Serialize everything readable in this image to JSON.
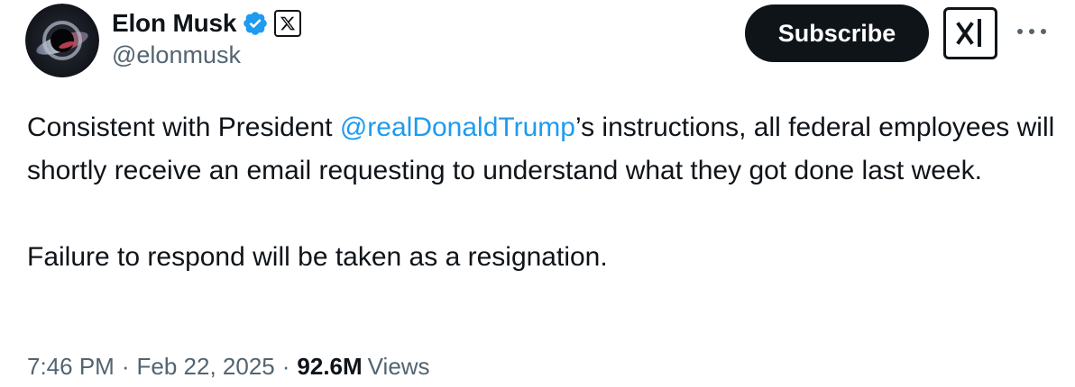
{
  "author": {
    "display_name": "Elon Musk",
    "handle": "@elonmusk",
    "verified": true,
    "affiliate_badge": "X"
  },
  "actions": {
    "subscribe_label": "Subscribe",
    "brand_logo": "xai-logo",
    "more_icon": "ellipsis-icon"
  },
  "tweet": {
    "text_before_mention": "Consistent with President ",
    "mention": "@realDonaldTrump",
    "text_after_mention": "’s instructions, all federal employees will shortly receive an email requesting to understand what they got done last week.",
    "paragraph_2": "Failure to respond will be taken as a resignation."
  },
  "meta": {
    "time": "7:46 PM",
    "separator": "·",
    "date": "Feb 22, 2025",
    "views_count": "92.6M",
    "views_label": "Views"
  },
  "colors": {
    "text": "#0f1419",
    "secondary": "#536471",
    "link": "#1d9bf0",
    "verified": "#1d9bf0",
    "button_bg": "#0f1419"
  }
}
